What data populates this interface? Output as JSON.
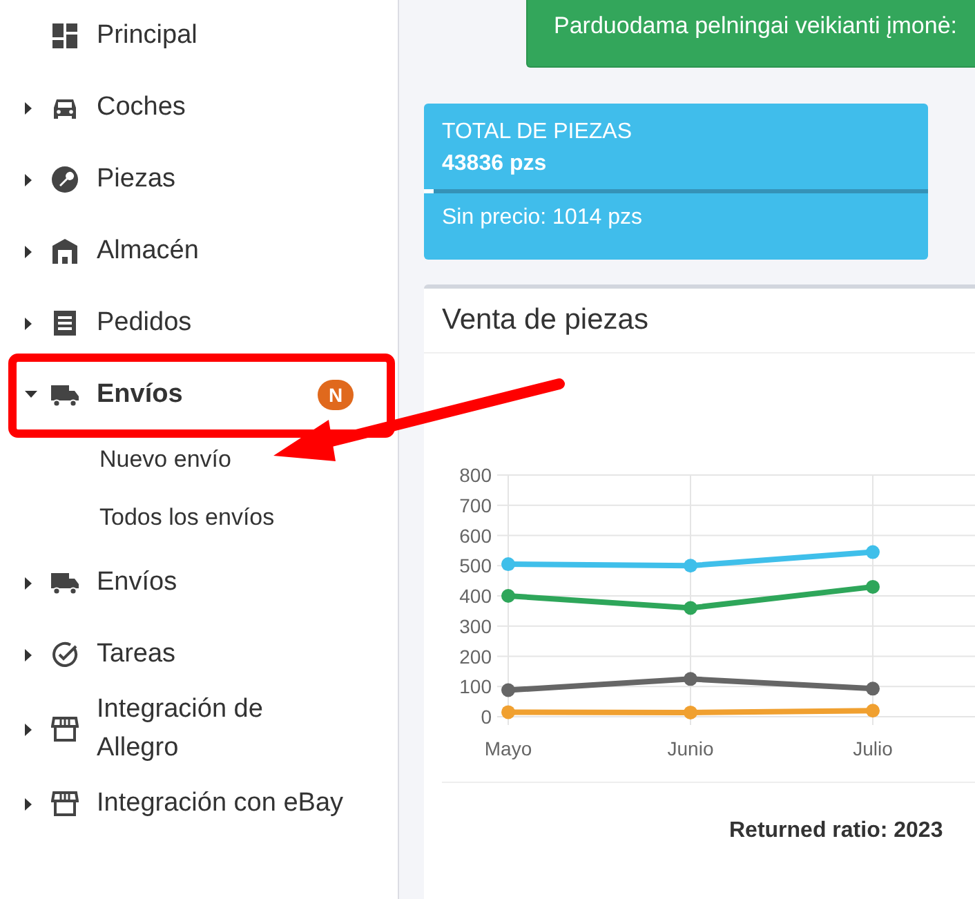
{
  "sidebar": {
    "items": [
      {
        "label": "Principal",
        "kind": "link"
      },
      {
        "label": "Coches",
        "kind": "group",
        "expanded": false
      },
      {
        "label": "Piezas",
        "kind": "group",
        "expanded": false
      },
      {
        "label": "Almacén",
        "kind": "group",
        "expanded": false
      },
      {
        "label": "Pedidos",
        "kind": "group",
        "expanded": false
      },
      {
        "label": "Envíos",
        "kind": "group",
        "expanded": true,
        "badge": "N",
        "children": [
          {
            "label": "Nuevo envío"
          },
          {
            "label": "Todos los envíos"
          }
        ]
      },
      {
        "label": "Envíos",
        "kind": "group",
        "expanded": false
      },
      {
        "label": "Tareas",
        "kind": "group",
        "expanded": false
      },
      {
        "label": "Integración de Allegro",
        "kind": "group",
        "expanded": false
      },
      {
        "label": "Integración con eBay",
        "kind": "group",
        "expanded": false
      }
    ]
  },
  "banner": {
    "text": "Parduodama pelningai veikianti įmonė:"
  },
  "info_box": {
    "title": "TOTAL DE PIEZAS",
    "value": "43836 pzs",
    "level": 0.02,
    "footer": "Sin precio: 1014 pzs"
  },
  "chart_card": {
    "title": "Venta de piezas",
    "footer": "Returned ratio: 2023",
    "chart_data": {
      "type": "line",
      "grid": true,
      "categories": [
        "Mayo",
        "Junio",
        "Julio"
      ],
      "ylim": [
        0,
        800
      ],
      "yticks": [
        0,
        100,
        200,
        300,
        400,
        500,
        600,
        700,
        800
      ],
      "series": [
        {
          "color": "#3fbfea",
          "marker": true,
          "values": [
            505,
            500,
            545
          ]
        },
        {
          "color": "#2ea65a",
          "marker": true,
          "values": [
            400,
            360,
            430
          ]
        },
        {
          "color": "#666666",
          "marker": true,
          "values": [
            88,
            125,
            93
          ]
        },
        {
          "color": "#f0a030",
          "marker": true,
          "values": [
            15,
            14,
            20
          ]
        }
      ]
    }
  }
}
